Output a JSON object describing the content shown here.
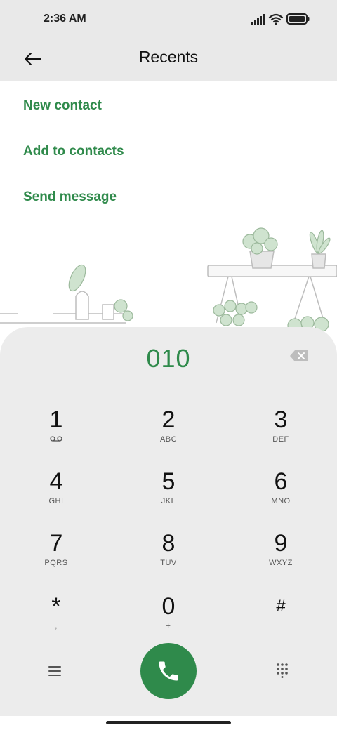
{
  "status_bar": {
    "time": "2:36 AM"
  },
  "header": {
    "title": "Recents"
  },
  "menu": {
    "items": [
      "New contact",
      "Add to contacts",
      "Send message"
    ]
  },
  "dialer": {
    "number": "010",
    "keys": [
      {
        "digit": "1",
        "letters": ""
      },
      {
        "digit": "2",
        "letters": "ABC"
      },
      {
        "digit": "3",
        "letters": "DEF"
      },
      {
        "digit": "4",
        "letters": "GHI"
      },
      {
        "digit": "5",
        "letters": "JKL"
      },
      {
        "digit": "6",
        "letters": "MNO"
      },
      {
        "digit": "7",
        "letters": "PQRS"
      },
      {
        "digit": "8",
        "letters": "TUV"
      },
      {
        "digit": "9",
        "letters": "WXYZ"
      },
      {
        "digit": "*",
        "letters": ","
      },
      {
        "digit": "0",
        "letters": "+"
      },
      {
        "digit": "#",
        "letters": ""
      }
    ]
  },
  "colors": {
    "accent": "#2f8a4b",
    "panel": "#ececec",
    "header": "#e9e9e9"
  },
  "icons": [
    "back-arrow-icon",
    "signal-icon",
    "wifi-icon",
    "battery-icon",
    "voicemail-icon",
    "backspace-icon",
    "phone-icon",
    "menu-icon",
    "dialpad-icon"
  ]
}
